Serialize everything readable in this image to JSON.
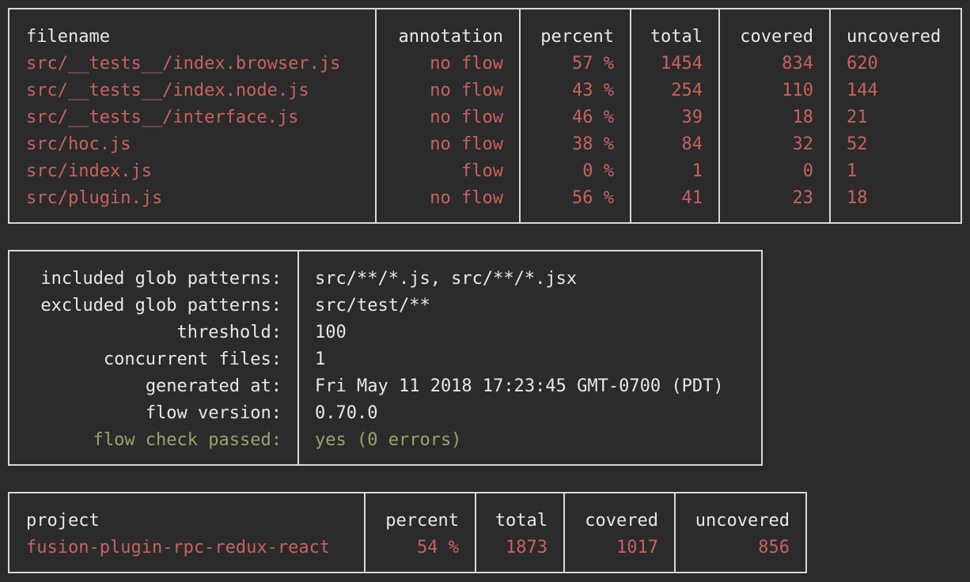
{
  "coverage_table": {
    "headers": {
      "filename": "filename",
      "annotation": "annotation",
      "percent": "percent",
      "total": "total",
      "covered": "covered",
      "uncovered": "uncovered"
    },
    "rows": [
      {
        "filename": "src/__tests__/index.browser.js",
        "annotation": "no flow",
        "percent": "57 %",
        "total": "1454",
        "covered": "834",
        "uncovered": "620"
      },
      {
        "filename": "src/__tests__/index.node.js",
        "annotation": "no flow",
        "percent": "43 %",
        "total": "254",
        "covered": "110",
        "uncovered": "144"
      },
      {
        "filename": "src/__tests__/interface.js",
        "annotation": "no flow",
        "percent": "46 %",
        "total": "39",
        "covered": "18",
        "uncovered": "21"
      },
      {
        "filename": "src/hoc.js",
        "annotation": "no flow",
        "percent": "38 %",
        "total": "84",
        "covered": "32",
        "uncovered": "52"
      },
      {
        "filename": "src/index.js",
        "annotation": "flow",
        "percent": "0 %",
        "total": "1",
        "covered": "0",
        "uncovered": "1"
      },
      {
        "filename": "src/plugin.js",
        "annotation": "no flow",
        "percent": "56 %",
        "total": "41",
        "covered": "23",
        "uncovered": "18"
      }
    ]
  },
  "settings": {
    "included_label": "included glob patterns:",
    "included_value": "src/**/*.js, src/**/*.jsx",
    "excluded_label": "excluded glob patterns:",
    "excluded_value": "src/test/**",
    "threshold_label": "threshold:",
    "threshold_value": "100",
    "concurrent_label": "concurrent files:",
    "concurrent_value": "1",
    "generated_label": "generated at:",
    "generated_value": "Fri May 11 2018 17:23:45 GMT-0700 (PDT)",
    "flow_version_label": "flow version:",
    "flow_version_value": "0.70.0",
    "flow_check_label": "flow check passed:",
    "flow_check_value": "yes (0 errors)"
  },
  "summary_table": {
    "headers": {
      "project": "project",
      "percent": "percent",
      "total": "total",
      "covered": "covered",
      "uncovered": "uncovered"
    },
    "row": {
      "project": "fusion-plugin-rpc-redux-react",
      "percent": "54 %",
      "total": "1873",
      "covered": "1017",
      "uncovered": "856"
    }
  },
  "colors": {
    "background": "#2b2b2b",
    "text": "#e8e8e8",
    "value_red": "#c9625d",
    "passed_green": "#9aa36a",
    "border": "#d8d8d8"
  }
}
